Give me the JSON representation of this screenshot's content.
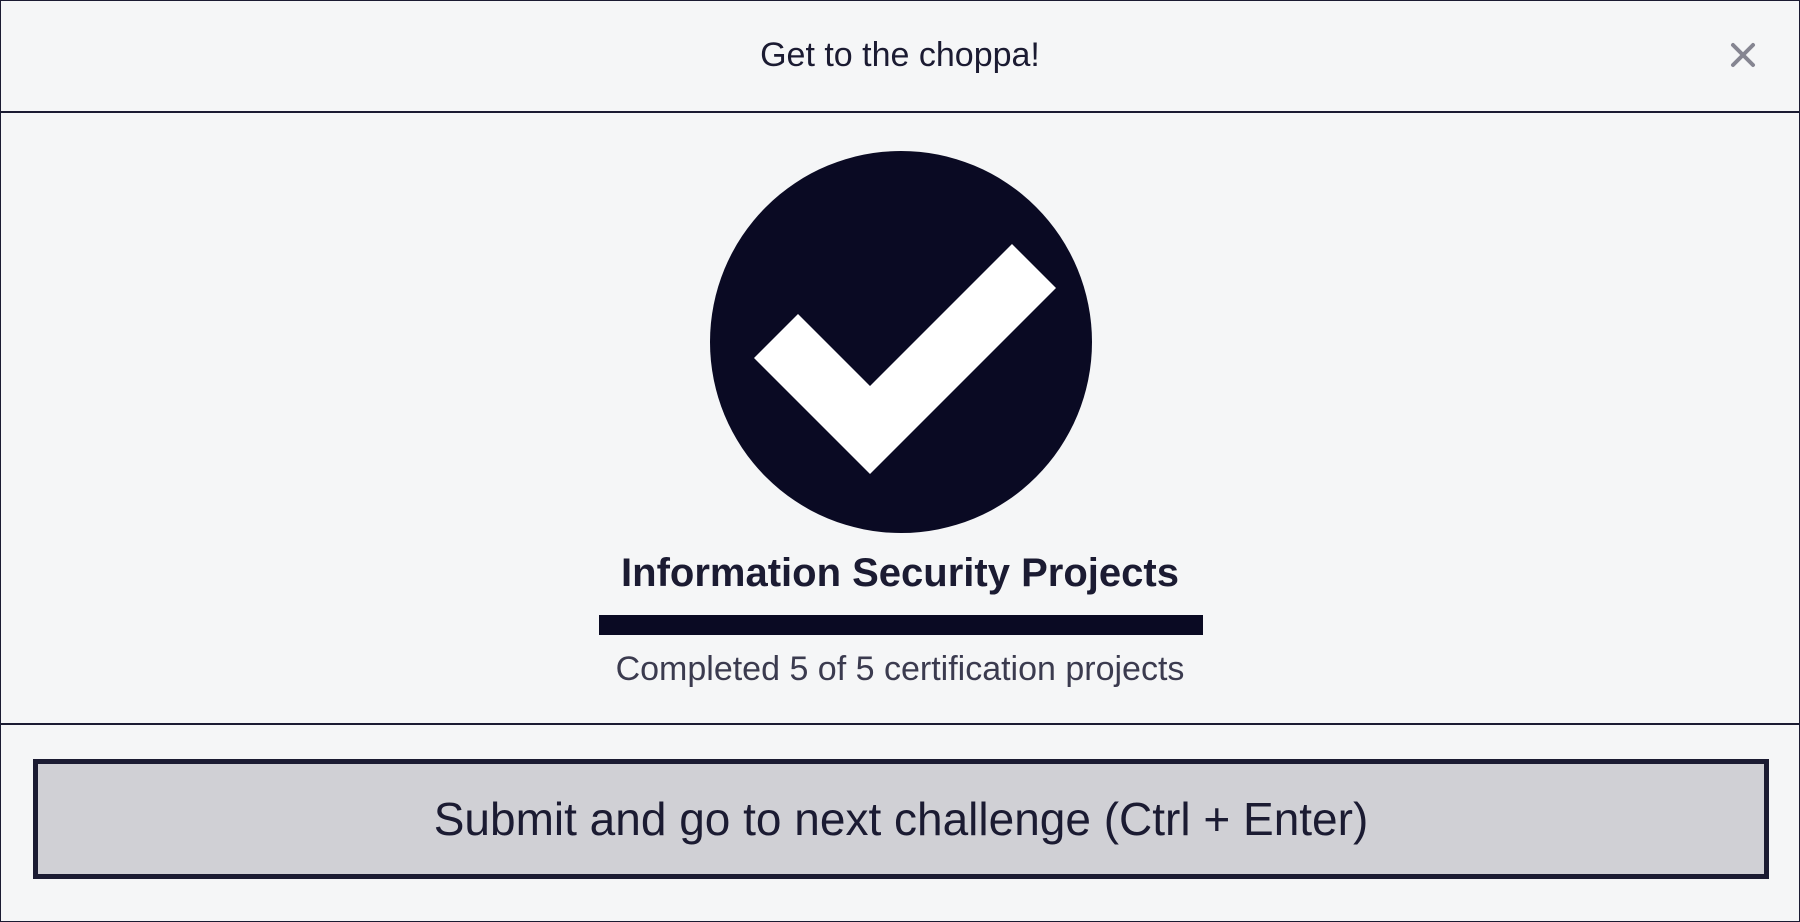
{
  "modal": {
    "title": "Get to the choppa!",
    "close_label": "×"
  },
  "progress": {
    "title": "Information Security Projects",
    "completed": 5,
    "total": 5,
    "fraction": 1.0,
    "text": "Completed 5 of 5 certification projects"
  },
  "footer": {
    "submit_label": "Submit and go to next challenge (Ctrl + Enter)"
  },
  "icons": {
    "close": "close-icon",
    "success": "checkmark-circle-icon"
  },
  "colors": {
    "background": "#f5f6f7",
    "primary": "#0a0a23",
    "text": "#1b1b32",
    "button_bg": "#d0d0d5",
    "muted_text": "#3b3b4f"
  }
}
